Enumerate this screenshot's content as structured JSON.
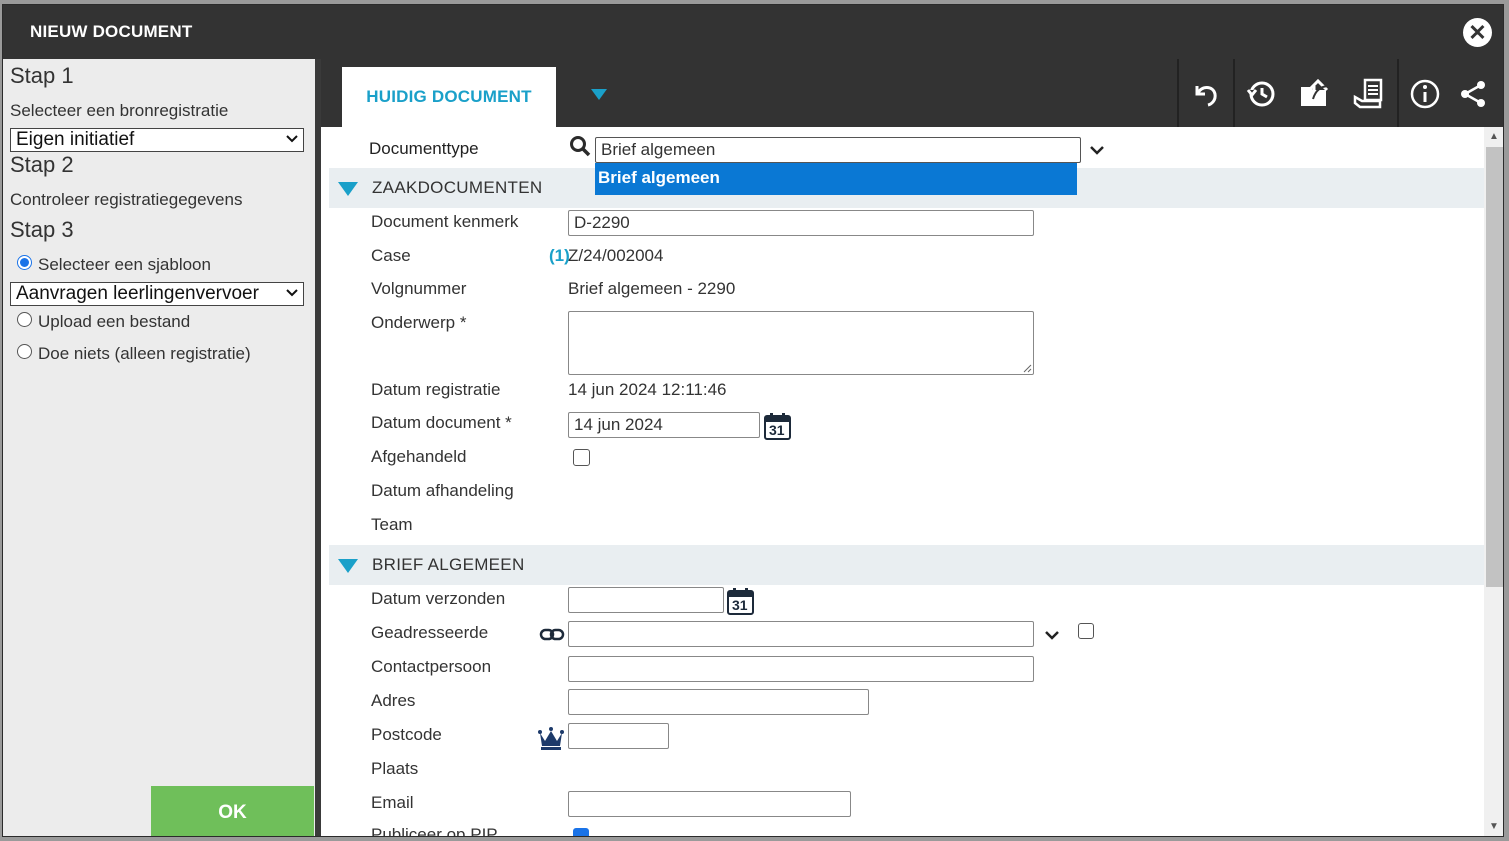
{
  "dialog": {
    "title": "NIEUW DOCUMENT"
  },
  "left": {
    "step1_heading": "Stap 1",
    "step1_text": "Selecteer een bronregistratie",
    "step1_select": "Eigen initiatief",
    "step2_heading": "Stap 2",
    "step2_text": "Controleer registratiegegevens",
    "step3_heading": "Stap 3",
    "options": [
      {
        "label": "Selecteer een sjabloon",
        "checked": true
      },
      {
        "label": "Upload een bestand",
        "checked": false
      },
      {
        "label": "Doe niets (alleen registratie)",
        "checked": false
      }
    ],
    "template_select": "Aanvragen leerlingenvervoer",
    "ok_label": "OK"
  },
  "toolbar": {
    "tab_label": "HUIDIG DOCUMENT",
    "icons": [
      "undo-icon",
      "history-icon",
      "folder-upload-icon",
      "scan-document-icon",
      "info-icon",
      "share-icon"
    ]
  },
  "form": {
    "doctype_label": "Documenttype",
    "doctype_value": "Brief algemeen",
    "doctype_option": "Brief algemeen",
    "section1_title": "ZAAKDOCUMENTEN",
    "kenmerk_label": "Document kenmerk",
    "kenmerk_value": "D-2290",
    "case_label": "Case",
    "case_count": "(1)",
    "case_value": "Z/24/002004",
    "volgnummer_label": "Volgnummer",
    "volgnummer_value": "Brief algemeen - 2290",
    "onderwerp_label": "Onderwerp *",
    "datum_reg_label": "Datum registratie",
    "datum_reg_value": "14 jun 2024 12:11:46",
    "datum_doc_label": "Datum document *",
    "datum_doc_value": "14 jun 2024",
    "calendar_day": "31",
    "afgehandeld_label": "Afgehandeld",
    "datum_afh_label": "Datum afhandeling",
    "team_label": "Team",
    "section2_title": "BRIEF ALGEMEEN",
    "datum_verz_label": "Datum verzonden",
    "geadresseerde_label": "Geadresseerde",
    "contactpersoon_label": "Contactpersoon",
    "adres_label": "Adres",
    "postcode_label": "Postcode",
    "plaats_label": "Plaats",
    "email_label": "Email",
    "publiceer_label": "Publiceer op PIP"
  },
  "colors": {
    "accent": "#1aa0c9",
    "ok": "#6fbf5a",
    "dark": "#333333",
    "selection": "#0a78d4"
  }
}
